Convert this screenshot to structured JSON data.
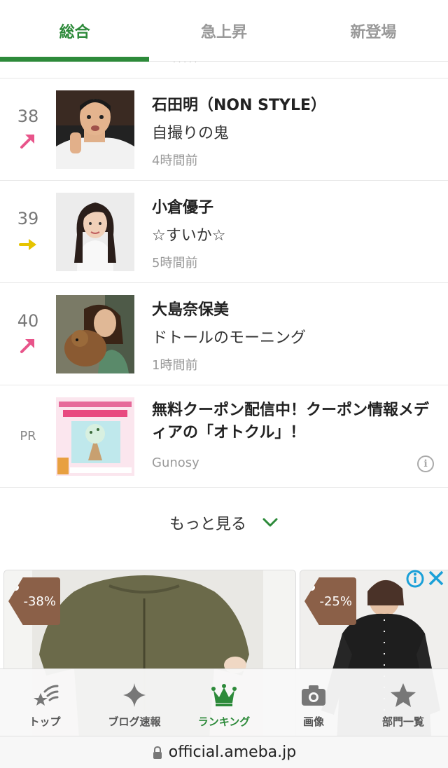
{
  "tabs": [
    {
      "label": "総合",
      "active": true
    },
    {
      "label": "急上昇",
      "active": false
    },
    {
      "label": "新登場",
      "active": false
    }
  ],
  "accent_color": "#2d8a3a",
  "ranking": [
    {
      "rank": "38",
      "trend": "up",
      "trend_color": "#e8548a",
      "name": "石田明（NON STYLE）",
      "title": "自撮りの鬼",
      "time": "4時間前",
      "thumb": "man-white-shirt"
    },
    {
      "rank": "39",
      "trend": "flat",
      "trend_color": "#e6c400",
      "name": "小倉優子",
      "title": "☆すいか☆",
      "time": "5時間前",
      "thumb": "woman-portrait"
    },
    {
      "rank": "40",
      "trend": "up",
      "trend_color": "#e8548a",
      "name": "大島奈保美",
      "title": "ドトールのモーニング",
      "time": "1時間前",
      "thumb": "woman-with-dog"
    }
  ],
  "pr": {
    "label": "PR",
    "title": "無料クーポン配信中！クーポン情報メディアの「オトクル」！",
    "source": "Gunosy",
    "info_icon": "info-icon"
  },
  "more": {
    "label": "もっと見る"
  },
  "ads": [
    {
      "discount": "-38%",
      "color": "#6b6a4a"
    },
    {
      "discount": "-25%",
      "color": "#1e1e1e"
    }
  ],
  "bottom_nav": [
    {
      "label": "トップ",
      "icon": "shooting-star-icon",
      "active": false
    },
    {
      "label": "ブログ速報",
      "icon": "sparkle-icon",
      "active": false
    },
    {
      "label": "ランキング",
      "icon": "crown-icon",
      "active": true
    },
    {
      "label": "画像",
      "icon": "camera-icon",
      "active": false
    },
    {
      "label": "部門一覧",
      "icon": "star-icon",
      "active": false
    }
  ],
  "url": "official.ameba.jp"
}
